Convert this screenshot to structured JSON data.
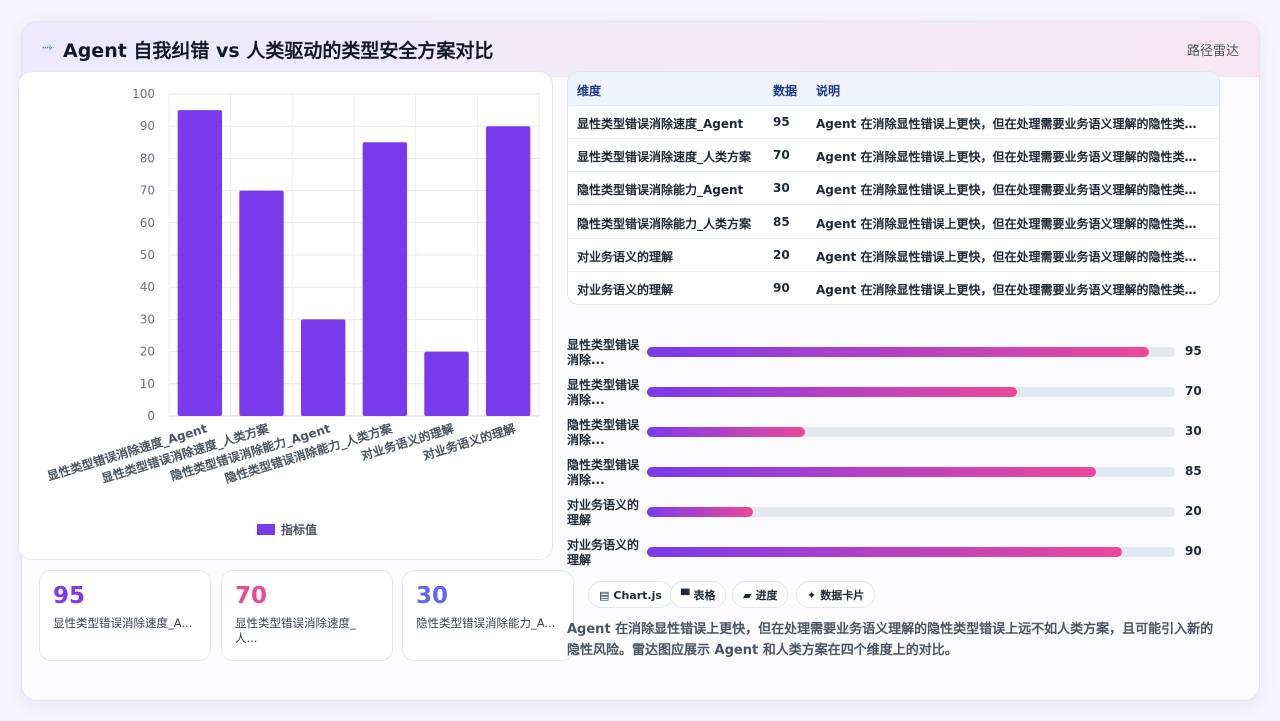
{
  "header": {
    "logo_icon": "arrow-logo-icon",
    "title": "Agent 自我纠错 vs 人类驱动的类型安全方案对比",
    "tag": "路径雷达"
  },
  "chart_data": {
    "type": "bar",
    "categories": [
      "显性类型错误消除速度_Agent",
      "显性类型错误消除速度_人类方案",
      "隐性类型错误消除能力_Agent",
      "隐性类型错误消除能力_人类方案",
      "对业务语义的理解",
      "对业务语义的理解"
    ],
    "series": [
      {
        "name": "指标值",
        "values": [
          95,
          70,
          30,
          85,
          20,
          90
        ],
        "color": "#7c3aed"
      }
    ],
    "ylim": [
      0,
      100
    ],
    "yticks": [
      0,
      10,
      20,
      30,
      40,
      50,
      60,
      70,
      80,
      90,
      100
    ],
    "grid": true,
    "legend": "bottom"
  },
  "stats": [
    {
      "value": "95",
      "label": "显性类型错误消除速度_A...",
      "color": "#7c3aed"
    },
    {
      "value": "70",
      "label": "显性类型错误消除速度_人...",
      "color": "#ec4899"
    },
    {
      "value": "30",
      "label": "隐性类型错误消除能力_A...",
      "color": "#6366f1"
    }
  ],
  "table": {
    "headers": [
      "维度",
      "数据",
      "说明"
    ],
    "rows": [
      [
        "显性类型错误消除速度_Agent",
        "95",
        "Agent 在消除显性错误上更快，但在处理需要业务语义理解的隐性类型..."
      ],
      [
        "显性类型错误消除速度_人类方案",
        "70",
        "Agent 在消除显性错误上更快，但在处理需要业务语义理解的隐性类型..."
      ],
      [
        "隐性类型错误消除能力_Agent",
        "30",
        "Agent 在消除显性错误上更快，但在处理需要业务语义理解的隐性类型..."
      ],
      [
        "隐性类型错误消除能力_人类方案",
        "85",
        "Agent 在消除显性错误上更快，但在处理需要业务语义理解的隐性类型..."
      ],
      [
        "对业务语义的理解",
        "20",
        "Agent 在消除显性错误上更快，但在处理需要业务语义理解的隐性类型..."
      ],
      [
        "对业务语义的理解",
        "90",
        "Agent 在消除显性错误上更快，但在处理需要业务语义理解的隐性类型..."
      ]
    ]
  },
  "progress": [
    {
      "label": "显性类型错误消除...",
      "value": 95,
      "text": "95"
    },
    {
      "label": "显性类型错误消除...",
      "value": 70,
      "text": "70"
    },
    {
      "label": "隐性类型错误消除...",
      "value": 30,
      "text": "30"
    },
    {
      "label": "隐性类型错误消除...",
      "value": 85,
      "text": "85"
    },
    {
      "label": "对业务语义的理解",
      "value": 20,
      "text": "20"
    },
    {
      "label": "对业务语义的理解",
      "value": 90,
      "text": "90"
    }
  ],
  "badges": [
    {
      "icon": "chart-icon",
      "glyph": "▤",
      "label": "Chart.js"
    },
    {
      "icon": "table-icon",
      "glyph": "▀",
      "label": "表格"
    },
    {
      "icon": "progress-icon",
      "glyph": "▰",
      "label": "进度"
    },
    {
      "icon": "card-icon",
      "glyph": "✦",
      "label": "数据卡片"
    }
  ],
  "note": "Agent 在消除显性错误上更快，但在处理需要业务语义理解的隐性类型错误上远不如人类方案，且可能引入新的隐性风险。雷达图应展示 Agent 和人类方案在四个维度上的对比。"
}
